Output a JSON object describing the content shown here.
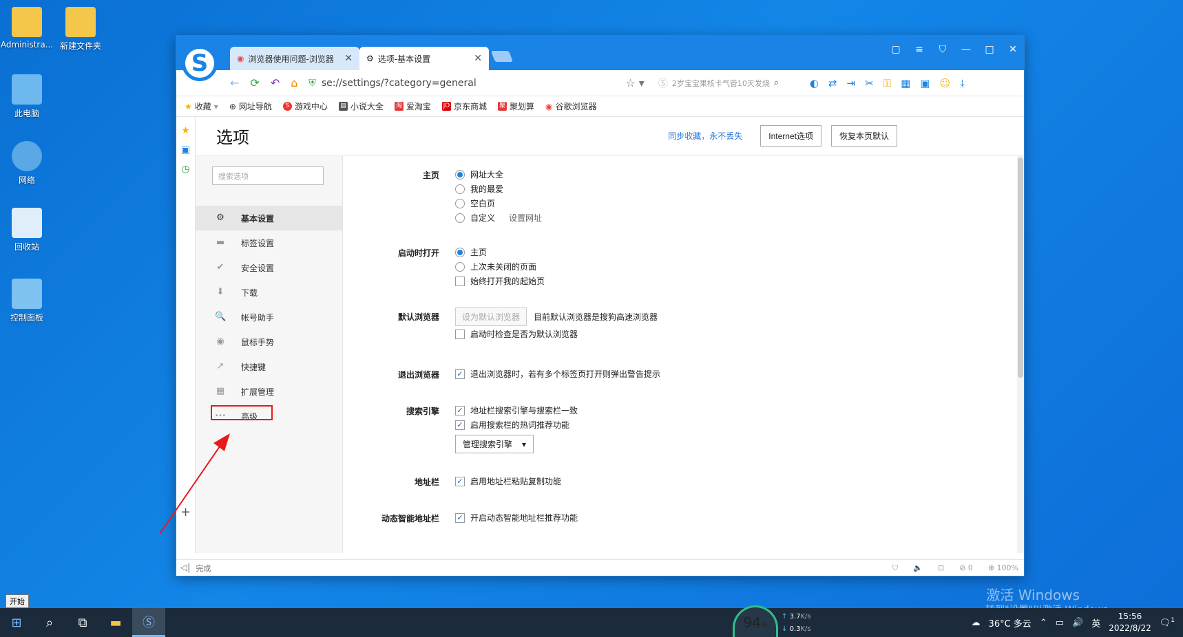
{
  "desktop": {
    "icons": [
      {
        "label": "Administra..."
      },
      {
        "label": "新建文件夹"
      },
      {
        "label": "此电脑"
      },
      {
        "label": "网络"
      },
      {
        "label": "回收站"
      },
      {
        "label": "控制面板"
      }
    ],
    "activation_title": "激活 Windows",
    "activation_sub": "转到\"设置\"以激活 Windows。"
  },
  "browser": {
    "tabs": [
      {
        "label": "浏览器使用问题-浏览器"
      },
      {
        "label": "选项-基本设置"
      }
    ],
    "address": "se://settings/?category=general",
    "search_hint": "2岁宝宝果核卡气管10天发烧",
    "bookmarks": [
      {
        "label": "收藏"
      },
      {
        "label": "网址导航"
      },
      {
        "label": "游戏中心"
      },
      {
        "label": "小说大全"
      },
      {
        "label": "爱淘宝"
      },
      {
        "label": "京东商城"
      },
      {
        "label": "聚划算"
      },
      {
        "label": "谷歌浏览器"
      }
    ],
    "status_done": "完成",
    "status_ad": "0",
    "zoom": "100%"
  },
  "options": {
    "title": "选项",
    "sync_link": "同步收藏，永不丢失",
    "internet_btn": "Internet选项",
    "restore_btn": "恢复本页默认",
    "search_placeholder": "搜索选项",
    "nav": [
      {
        "label": "基本设置",
        "icon": "⚙"
      },
      {
        "label": "标签设置",
        "icon": "▬"
      },
      {
        "label": "安全设置",
        "icon": "✔"
      },
      {
        "label": "下载",
        "icon": "⬇"
      },
      {
        "label": "帐号助手",
        "icon": "🔍"
      },
      {
        "label": "鼠标手势",
        "icon": "◉"
      },
      {
        "label": "快捷键",
        "icon": "↗"
      },
      {
        "label": "扩展管理",
        "icon": "▦"
      },
      {
        "label": "高级",
        "icon": "•••"
      }
    ],
    "homepage": {
      "label": "主页",
      "choices": [
        "网址大全",
        "我的最爱",
        "空白页",
        "自定义"
      ],
      "set_url": "设置网址"
    },
    "startup": {
      "label": "启动时打开",
      "choices": [
        "主页",
        "上次未关闭的页面"
      ],
      "always_start": "始终打开我的起始页"
    },
    "default_browser": {
      "label": "默认浏览器",
      "button": "设为默认浏览器",
      "status": "目前默认浏览器是搜狗高速浏览器",
      "check": "启动时检查是否为默认浏览器"
    },
    "exit": {
      "label": "退出浏览器",
      "check": "退出浏览器时，若有多个标签页打开则弹出警告提示"
    },
    "search_engine": {
      "label": "搜索引擎",
      "check1": "地址栏搜索引擎与搜索栏一致",
      "check2": "启用搜索栏的热词推荐功能",
      "manage": "管理搜索引擎"
    },
    "addressbar": {
      "label": "地址栏",
      "check": "启用地址栏粘贴复制功能"
    },
    "smart_addr": {
      "label": "动态智能地址栏",
      "check": "开启动态智能地址栏推荐功能"
    }
  },
  "taskbar": {
    "start_label": "开始",
    "cpu": "94",
    "cpu_unit": "%",
    "up_speed": "3.7",
    "down_speed": "0.3",
    "speed_unit": "K/s",
    "weather": "36°C 多云",
    "ime": "英",
    "time": "15:56",
    "date": "2022/8/22",
    "notif_count": "1"
  },
  "colors": {
    "accent": "#1a84e6",
    "highlight": "#e61b1b"
  }
}
